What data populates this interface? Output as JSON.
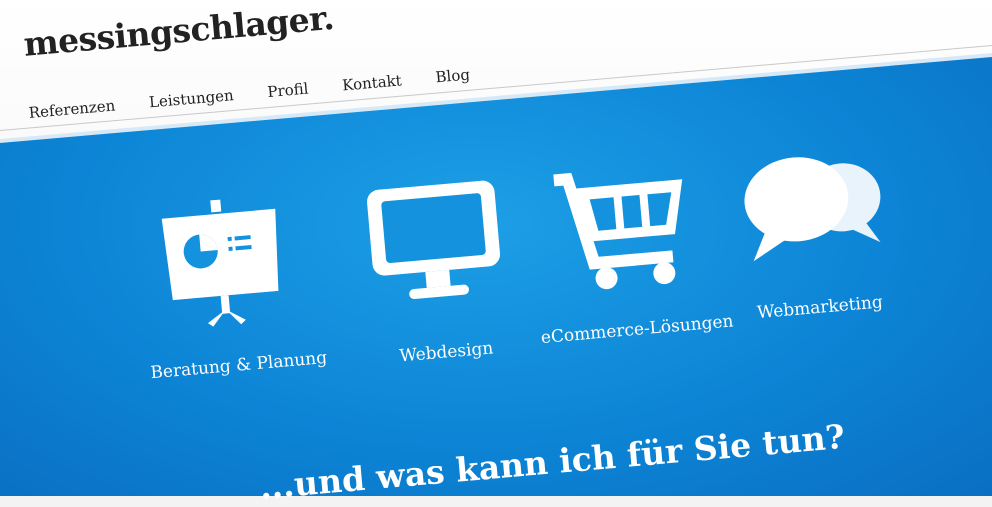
{
  "brand": {
    "name": "messingschlager."
  },
  "nav": {
    "items": [
      {
        "label": "Referenzen"
      },
      {
        "label": "Leistungen"
      },
      {
        "label": "Profil"
      },
      {
        "label": "Kontakt"
      },
      {
        "label": "Blog"
      }
    ]
  },
  "services": [
    {
      "label": "Beratung & Planung",
      "icon": "presentation-board-icon"
    },
    {
      "label": "Webdesign",
      "icon": "monitor-icon"
    },
    {
      "label": "eCommerce-Lösungen",
      "icon": "shopping-cart-icon"
    },
    {
      "label": "Webmarketing",
      "icon": "speech-bubbles-icon"
    }
  ],
  "cta": {
    "text": "...und was kann ich für Sie tun?"
  },
  "colors": {
    "hero": "#1592dd",
    "text_dark": "#222222",
    "icon": "#ffffff"
  }
}
